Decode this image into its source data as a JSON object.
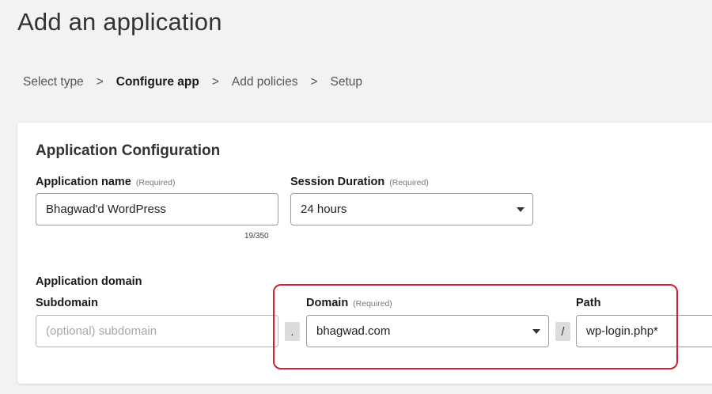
{
  "header": {
    "title": "Add an application"
  },
  "breadcrumb": {
    "steps": [
      "Select type",
      "Configure app",
      "Add policies",
      "Setup"
    ],
    "separator": ">"
  },
  "config": {
    "title": "Application Configuration",
    "app_name": {
      "label": "Application name",
      "required": "(Required)",
      "value": "Bhagwad'd WordPress",
      "counter": "19/350"
    },
    "session": {
      "label": "Session Duration",
      "required": "(Required)",
      "value": "24 hours"
    },
    "app_domain": {
      "label": "Application domain",
      "subdomain": {
        "label": "Subdomain",
        "placeholder": "(optional) subdomain"
      },
      "dot": ".",
      "domain": {
        "label": "Domain",
        "required": "(Required)",
        "value": "bhagwad.com"
      },
      "slash": "/",
      "path": {
        "label": "Path",
        "value": "wp-login.php*"
      }
    }
  },
  "colors": {
    "highlight": "#d42032",
    "background": "#f2f2f2"
  }
}
